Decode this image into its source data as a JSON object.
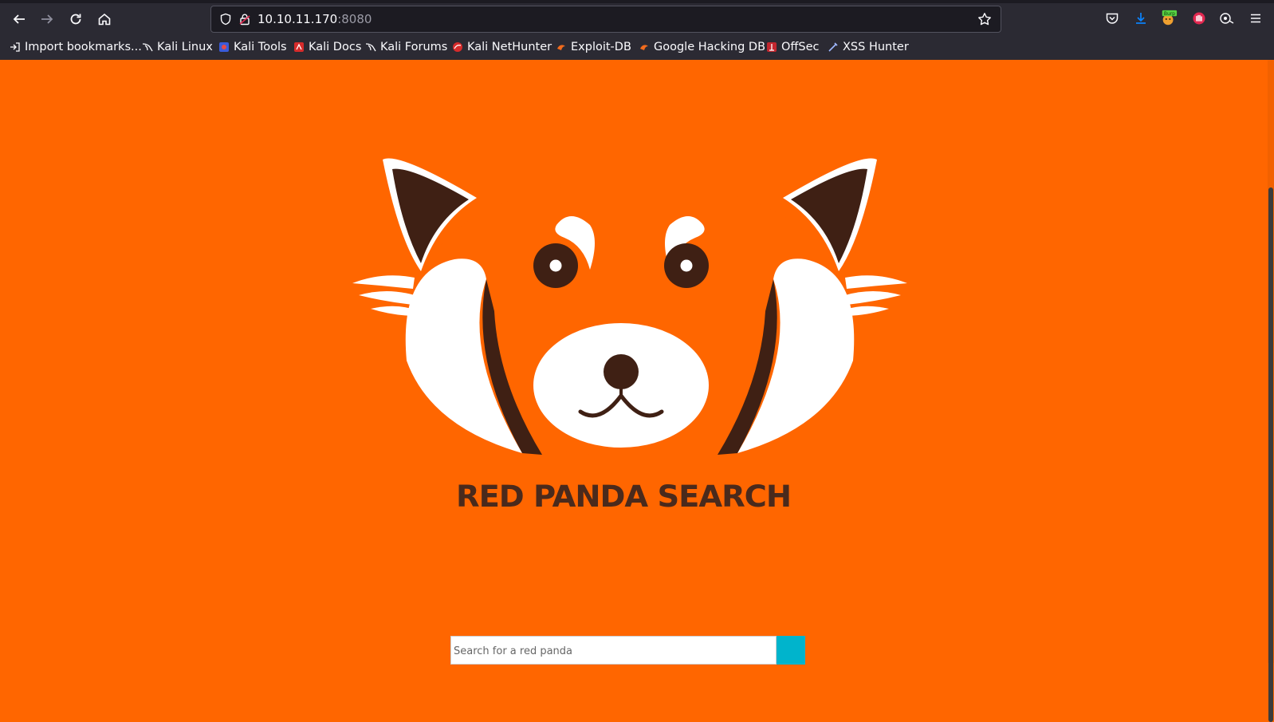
{
  "browser": {
    "url_host": "10.10.11.170",
    "url_port": ":8080",
    "icons": [
      "back-icon",
      "forward-icon",
      "reload-icon",
      "home-icon",
      "shield-icon",
      "lock-icon",
      "star-icon",
      "pocket-icon",
      "download-icon",
      "burp-icon",
      "extension-icon",
      "extension-icon",
      "menu-icon"
    ],
    "extension_burp_label": "Burp",
    "colors": {
      "chrome": "#2b2a33",
      "urlbar": "#1c1b22",
      "text": "#fbfbfe",
      "download": "#0060df"
    }
  },
  "bookmarks": [
    {
      "label": "Import bookmarks..."
    },
    {
      "label": "Kali Linux"
    },
    {
      "label": "Kali Tools"
    },
    {
      "label": "Kali Docs"
    },
    {
      "label": "Kali Forums"
    },
    {
      "label": "Kali NetHunter"
    },
    {
      "label": "Exploit-DB"
    },
    {
      "label": "Google Hacking DB"
    },
    {
      "label": "OffSec"
    },
    {
      "label": "XSS Hunter"
    }
  ],
  "page": {
    "title": "RED PANDA SEARCH",
    "search_placeholder": "Search for a red panda",
    "colors": {
      "background": "#ff6600",
      "panda_dark": "#3f2014",
      "search_button": "#00b4cc"
    }
  }
}
